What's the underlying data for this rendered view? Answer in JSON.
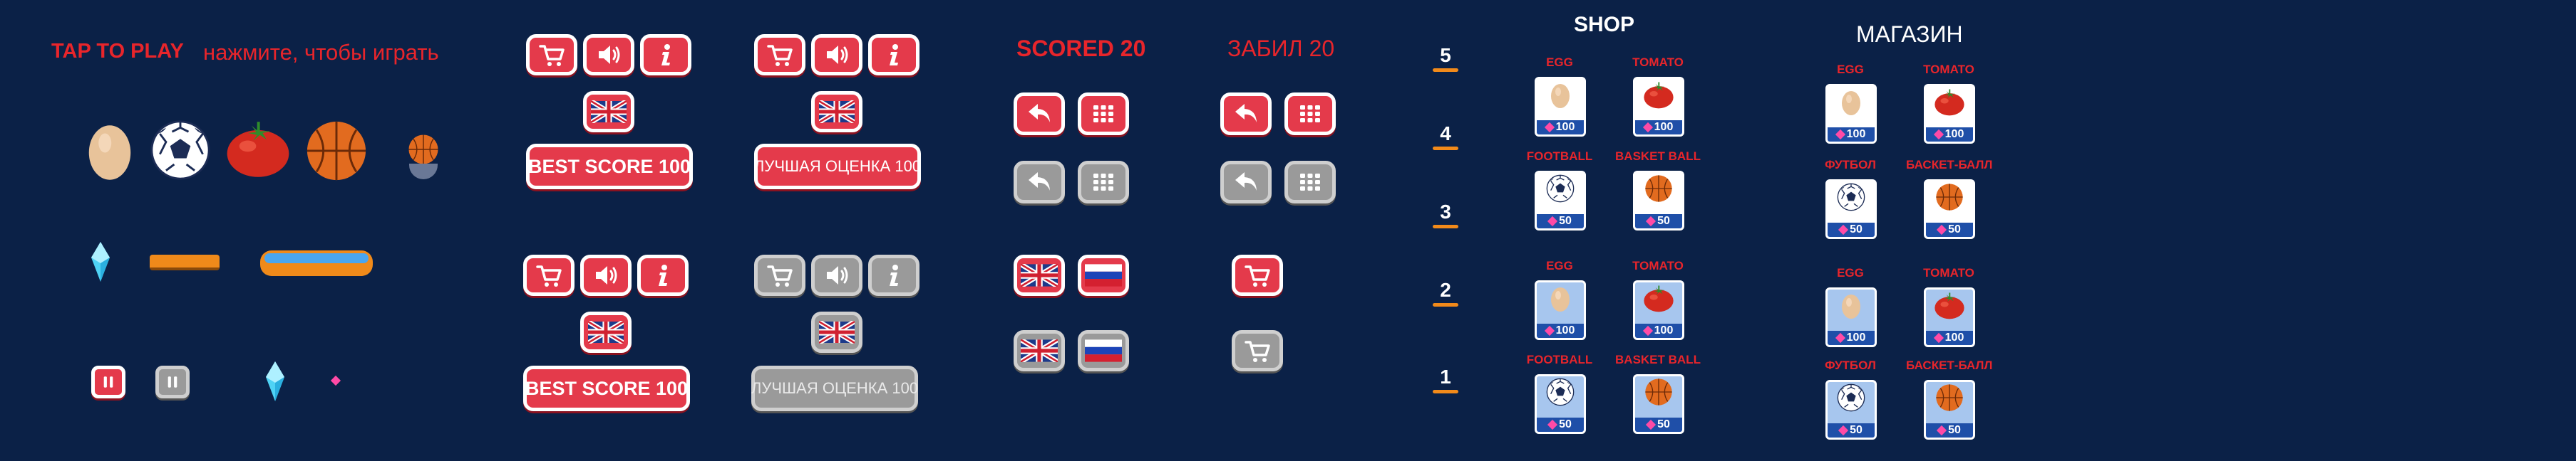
{
  "tap_to_play": "TAP TO PLAY",
  "tap_to_play_ru": "нажмите, чтобы играть",
  "best_score_label": "BEST SCORE 100",
  "best_score_label_ru": "ЛУЧШАЯ ОЦЕНКА 100",
  "scored_label": "SCORED 20",
  "scored_label_ru": "ЗАБИЛ 20",
  "shop_title": "SHOP",
  "shop_title_ru": "МАГАЗИН",
  "level_numbers": [
    "5",
    "4",
    "3",
    "2",
    "1"
  ],
  "shop_en": {
    "egg": "EGG",
    "tomato": "TOMATO",
    "football": "FOOTBALL",
    "basketball": "BASKET BALL",
    "price_100": "100",
    "price_50": "50"
  },
  "shop_ru": {
    "egg": "EGG",
    "tomato": "TOMATO",
    "football": "ФУТБОЛ",
    "basketball": "БАСКЕТ-БАЛЛ",
    "price_100": "100",
    "price_50": "50"
  },
  "colors": {
    "background": "#0b2147",
    "accent_red": "#e43a4b",
    "text_red": "#e8252b",
    "disabled_gray": "#9a9a9a",
    "price_bar": "#1f4fa8",
    "gem_pink": "#ff4aa6",
    "level_bar": "#f28a1a"
  },
  "icons": [
    "cart-icon",
    "sound-icon",
    "info-icon",
    "uk-flag-icon",
    "ru-flag-icon",
    "back-arrow-icon",
    "menu-grid-icon",
    "pause-icon",
    "diamond-icon",
    "egg-icon",
    "football-icon",
    "tomato-icon",
    "basketball-icon",
    "platform-icon"
  ]
}
